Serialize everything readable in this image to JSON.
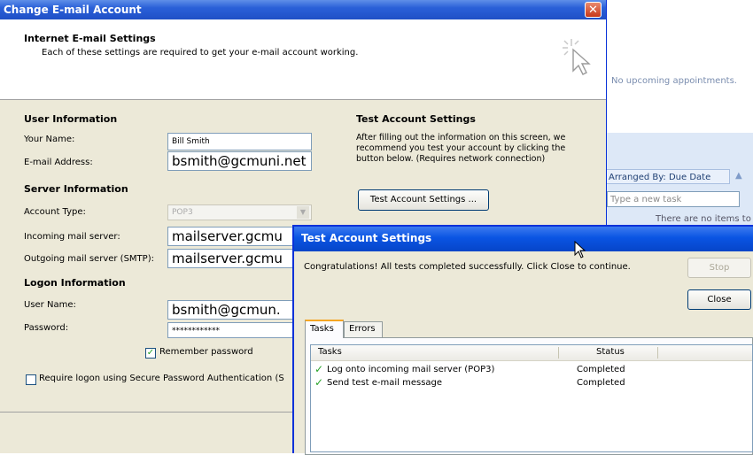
{
  "background": {
    "appointments_text": "No upcoming appointments.",
    "arranged_by": "Arranged By: Due Date",
    "task_placeholder": "Type a new task",
    "no_items": "There are no items to"
  },
  "main_dialog": {
    "title": "Change E-mail Account",
    "close_glyph": "✕",
    "header": {
      "title": "Internet E-mail Settings",
      "subtitle": "Each of these settings are required to get your e-mail account working."
    },
    "user_info": {
      "heading": "User Information",
      "name_label": "Your Name:",
      "name_value": "Bill Smith",
      "email_label": "E-mail Address:",
      "email_value": "bsmith@gcmuni.net"
    },
    "server_info": {
      "heading": "Server Information",
      "account_type_label": "Account Type:",
      "account_type_value": "POP3",
      "incoming_label": "Incoming mail server:",
      "incoming_value": "mailserver.gcmu",
      "outgoing_label": "Outgoing mail server (SMTP):",
      "outgoing_value": "mailserver.gcmu"
    },
    "logon_info": {
      "heading": "Logon Information",
      "username_label": "User Name:",
      "username_value": "bsmith@gcmun.",
      "password_label": "Password:",
      "password_value": "************",
      "remember_label": "Remember password",
      "remember_checked": true,
      "spa_label": "Require logon using Secure Password Authentication (S",
      "spa_checked": false
    },
    "test_settings": {
      "heading": "Test Account Settings",
      "description": "After filling out the information on this screen, we recommend you test your account by clicking the button below. (Requires network connection)",
      "button_label": "Test Account Settings ..."
    }
  },
  "test_dialog": {
    "title": "Test Account Settings",
    "message": "Congratulations! All tests completed successfully. Click Close to continue.",
    "stop_label": "Stop",
    "close_label": "Close",
    "tabs": [
      "Tasks",
      "Errors"
    ],
    "columns": [
      "Tasks",
      "Status"
    ],
    "rows": [
      {
        "task": "Log onto incoming mail server (POP3)",
        "status": "Completed"
      },
      {
        "task": "Send test e-mail message",
        "status": "Completed"
      }
    ],
    "check_glyph": "✓"
  }
}
